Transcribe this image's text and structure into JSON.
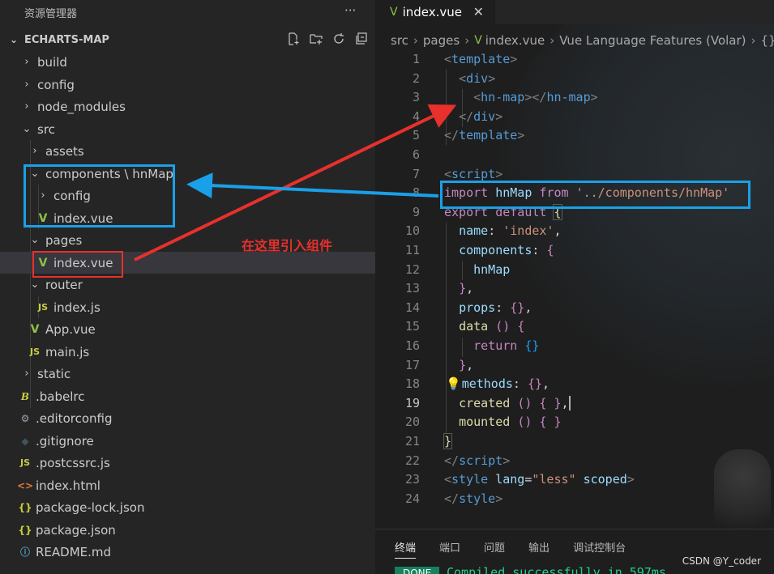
{
  "sidebar": {
    "title": "资源管理器",
    "more_icon": "ellipsis-icon",
    "section": "ECHARTS-MAP",
    "actions": [
      "new-file-icon",
      "new-folder-icon",
      "refresh-icon",
      "collapse-icon"
    ],
    "items": [
      {
        "label": "build",
        "chev": ">"
      },
      {
        "label": "config",
        "chev": ">"
      },
      {
        "label": "node_modules",
        "chev": ">"
      },
      {
        "label": "src",
        "chev": "v"
      },
      {
        "label": "assets",
        "chev": ">"
      },
      {
        "label": "components \\ hnMap",
        "chev": "v"
      },
      {
        "label": "config",
        "chev": ">"
      },
      {
        "label": "index.vue",
        "icon": "V"
      },
      {
        "label": "pages",
        "chev": "v"
      },
      {
        "label": "index.vue",
        "icon": "V"
      },
      {
        "label": "router",
        "chev": "v"
      },
      {
        "label": "index.js",
        "icon": "JS"
      },
      {
        "label": "App.vue",
        "icon": "V"
      },
      {
        "label": "main.js",
        "icon": "JS"
      },
      {
        "label": "static",
        "chev": ">"
      },
      {
        "label": ".babelrc",
        "icon": "B"
      },
      {
        "label": ".editorconfig",
        "icon": "⚙"
      },
      {
        "label": ".gitignore",
        "icon": "◆"
      },
      {
        "label": ".postcssrc.js",
        "icon": "JS"
      },
      {
        "label": "index.html",
        "icon": "<>"
      },
      {
        "label": "package-lock.json",
        "icon": "{}"
      },
      {
        "label": "package.json",
        "icon": "{}"
      },
      {
        "label": "README.md",
        "icon": "ⓘ"
      }
    ]
  },
  "editor": {
    "tab": {
      "label": "index.vue",
      "icon": "V",
      "close": "✕"
    },
    "breadcrumb": [
      "src",
      "pages",
      "index.vue",
      "Vue Language Features (Volar)",
      "{}"
    ],
    "line_numbers": [
      "1",
      "2",
      "3",
      "4",
      "5",
      "6",
      "7",
      "8",
      "9",
      "10",
      "11",
      "12",
      "13",
      "14",
      "15",
      "16",
      "17",
      "18",
      "19",
      "20",
      "21",
      "22",
      "23",
      "24"
    ],
    "active_line": "19",
    "code": {
      "template_tag": "template",
      "div_tag": "div",
      "hn_map_tag": "hn-map",
      "script_tag": "script",
      "import_kw": "import",
      "import_id": "hnMap",
      "from_kw": "from",
      "import_path": "'../components/hnMap'",
      "export_kw": "export",
      "default_kw": "default",
      "name_key": "name",
      "name_val": "'index'",
      "components_key": "components",
      "component_id": "hnMap",
      "props_key": "props",
      "data_fn": "data",
      "return_kw": "return",
      "methods_key": "methods",
      "created_fn": "created",
      "mounted_fn": "mounted",
      "style_tag": "style",
      "lang_attr": "lang",
      "lang_val": "\"less\"",
      "scoped_attr": "scoped"
    }
  },
  "panel": {
    "tabs": [
      "终端",
      "端口",
      "问题",
      "输出",
      "调试控制台"
    ],
    "status_badge": "DONE",
    "status_text": "Compiled successfully in 597ms"
  },
  "annotation": {
    "note": "在这里引入组件"
  },
  "watermark": "CSDN @Y_coder"
}
